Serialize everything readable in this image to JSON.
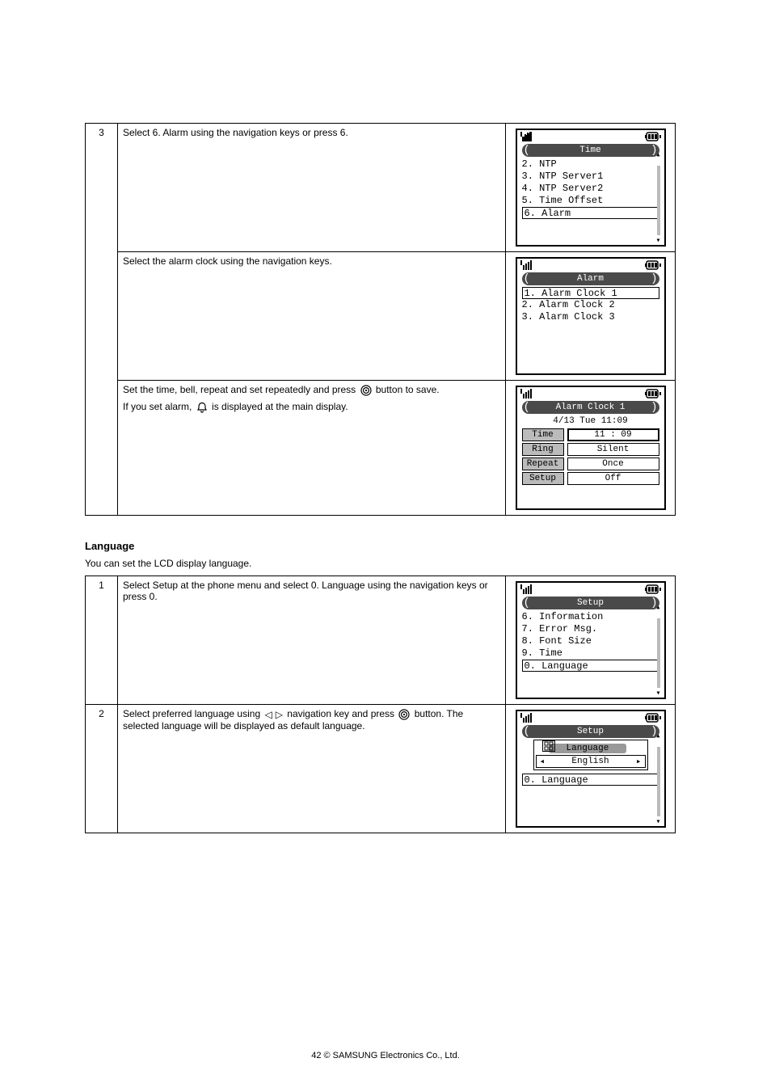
{
  "section1": {
    "step_no": "3",
    "r1_text": "Select 6. Alarm using the navigation keys or press 6.",
    "r2_text": "Select the alarm clock using the navigation keys.",
    "r3a": "Set the time, bell, repeat and set repeatedly and press",
    "r3b": "button to save.",
    "note1": "If you set alarm, ",
    "note2": " is displayed at the main display.",
    "screens": {
      "time": {
        "title": "Time",
        "items": [
          "2. NTP",
          "3. NTP Server1",
          "4. NTP Server2",
          "5. Time Offset",
          "6. Alarm"
        ],
        "selected_index": 4
      },
      "alarm": {
        "title": "Alarm",
        "items": [
          "1. Alarm Clock 1",
          "2. Alarm Clock 2",
          "3. Alarm Clock 3"
        ],
        "selected_index": 0
      },
      "alarm_clock": {
        "title": "Alarm Clock 1",
        "date": "4/13 Tue 11:09",
        "rows": [
          {
            "k": "Time",
            "v": "11 : 09",
            "sel": true
          },
          {
            "k": "Ring",
            "v": "Silent"
          },
          {
            "k": "Repeat",
            "v": "Once"
          },
          {
            "k": "Setup",
            "v": "Off"
          }
        ]
      }
    }
  },
  "heading": "Language",
  "intro": "You can set the LCD display language.",
  "section2": {
    "r1_step": "1",
    "r1_text": "Select Setup at the phone menu and select 0. Language using the navigation keys or press 0.",
    "r2_step": "2",
    "r2a": "Select preferred language using",
    "r2b": " navigation key and press ",
    "r2c": " button. The selected language will be displayed as default language.",
    "screens": {
      "setup": {
        "title": "Setup",
        "items": [
          "6. Information",
          "7. Error Msg.",
          "8. Font Size",
          "9. Time",
          "0. Language"
        ],
        "selected_index": 4
      },
      "language": {
        "title": "Setup",
        "lang_label": "Language",
        "lang_value": "English",
        "bottom": "0. Language"
      }
    }
  },
  "footer": "42   © SAMSUNG Electronics Co., Ltd.",
  "icons": {
    "ok": "ok-target-icon",
    "bell": "bell-icon",
    "left": "◁",
    "right": "▷"
  }
}
